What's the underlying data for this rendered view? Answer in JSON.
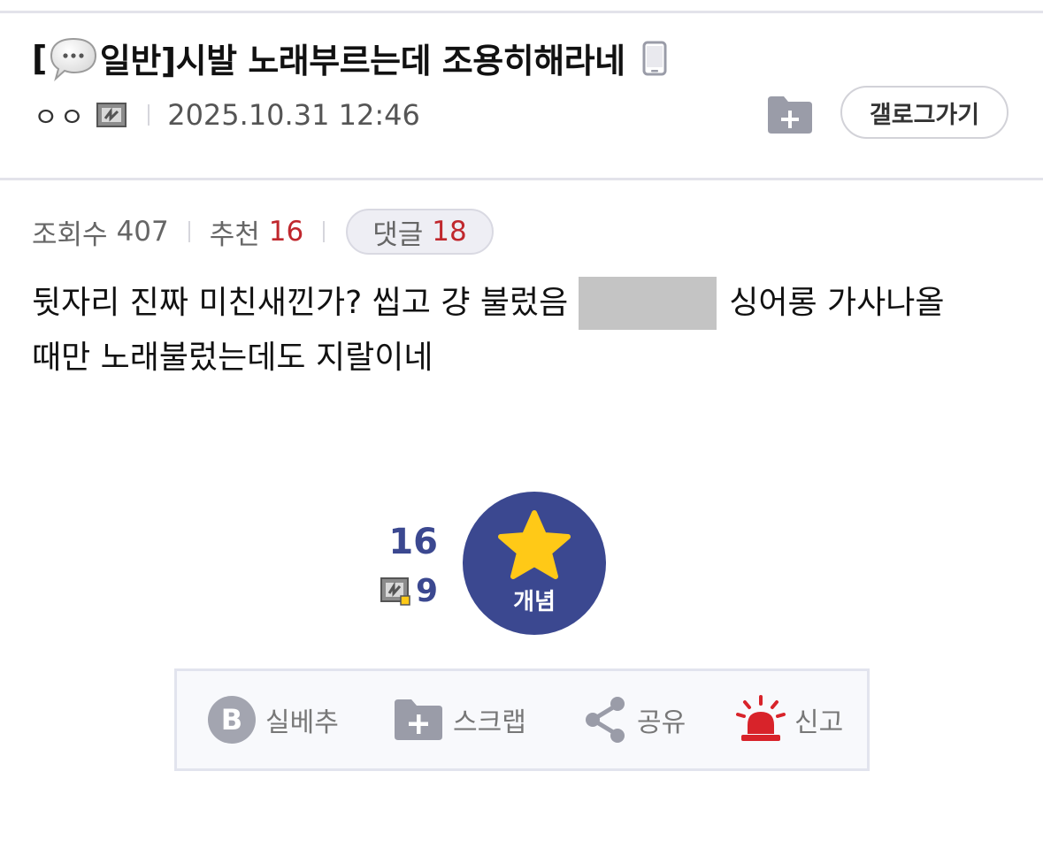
{
  "post": {
    "bracket_open": "[",
    "category": "일반]",
    "title": " 시발 노래부르는데 조용히해라네",
    "author": "ㅇㅇ",
    "date": "2025.10.31 12:46",
    "gallog_button": "갤로그가기"
  },
  "stats": {
    "views_label": "조회수",
    "views": "407",
    "reco_label": "추천",
    "reco": "16",
    "comments_label": "댓글",
    "comments": "18"
  },
  "content": {
    "line1_before": "뒷자리 진짜 미친새낀가? 씹고 걍 불렀음",
    "line1_after": "싱어롱 가사나올",
    "line2": "때만 노래불렀는데도 지랄이네"
  },
  "recommend": {
    "count": "16",
    "fixed_count": "9",
    "button_label": "개념"
  },
  "actions": [
    {
      "label": "실베추",
      "icon": "b-circle-icon"
    },
    {
      "label": "스크랩",
      "icon": "folder-plus-icon"
    },
    {
      "label": "공유",
      "icon": "share-icon"
    },
    {
      "label": "신고",
      "icon": "siren-icon"
    }
  ],
  "colors": {
    "accent": "#3b4890",
    "highlight_red": "#c0272d",
    "star_yellow": "#ffc917",
    "icon_gray": "#9a9ca8",
    "siren_red": "#d8232a"
  }
}
